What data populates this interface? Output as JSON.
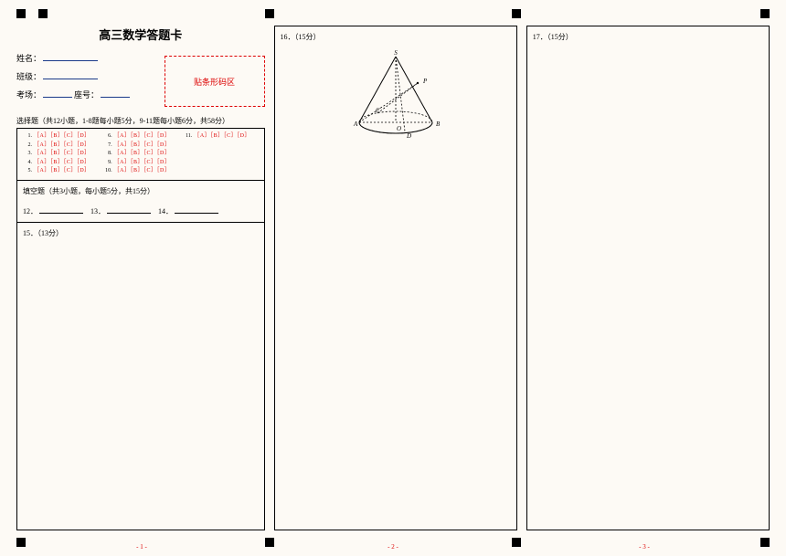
{
  "title": "高三数学答题卡",
  "info": {
    "name_label": "姓名：",
    "class_label": "班级：",
    "room_label": "考场：",
    "seat_label": "座号：",
    "barcode_label": "贴条形码区"
  },
  "mcq": {
    "header": "选择题（共12小题，1-8题每小题5分，9-11题每小题6分，共58分）",
    "bubble_text": "［A］［B］［C］［D］",
    "items": [
      "1.",
      "2.",
      "3.",
      "4.",
      "5.",
      "6.",
      "7.",
      "8.",
      "9.",
      "10.",
      "11."
    ]
  },
  "fill": {
    "header": "填空题（共3小题，每小题5分，共15分）",
    "q12": "12．",
    "q13": "13．",
    "q14": "14．"
  },
  "q15": {
    "head": "15．（13分）"
  },
  "q16": {
    "head": "16．（15分）",
    "labels": {
      "S": "S",
      "P": "P",
      "A": "A",
      "B": "B",
      "C": "C",
      "O": "O",
      "D": "D"
    }
  },
  "q17": {
    "head": "17．（15分）"
  },
  "pages": {
    "p1": "- 1 -",
    "p2": "- 2 -",
    "p3": "- 3 -"
  }
}
